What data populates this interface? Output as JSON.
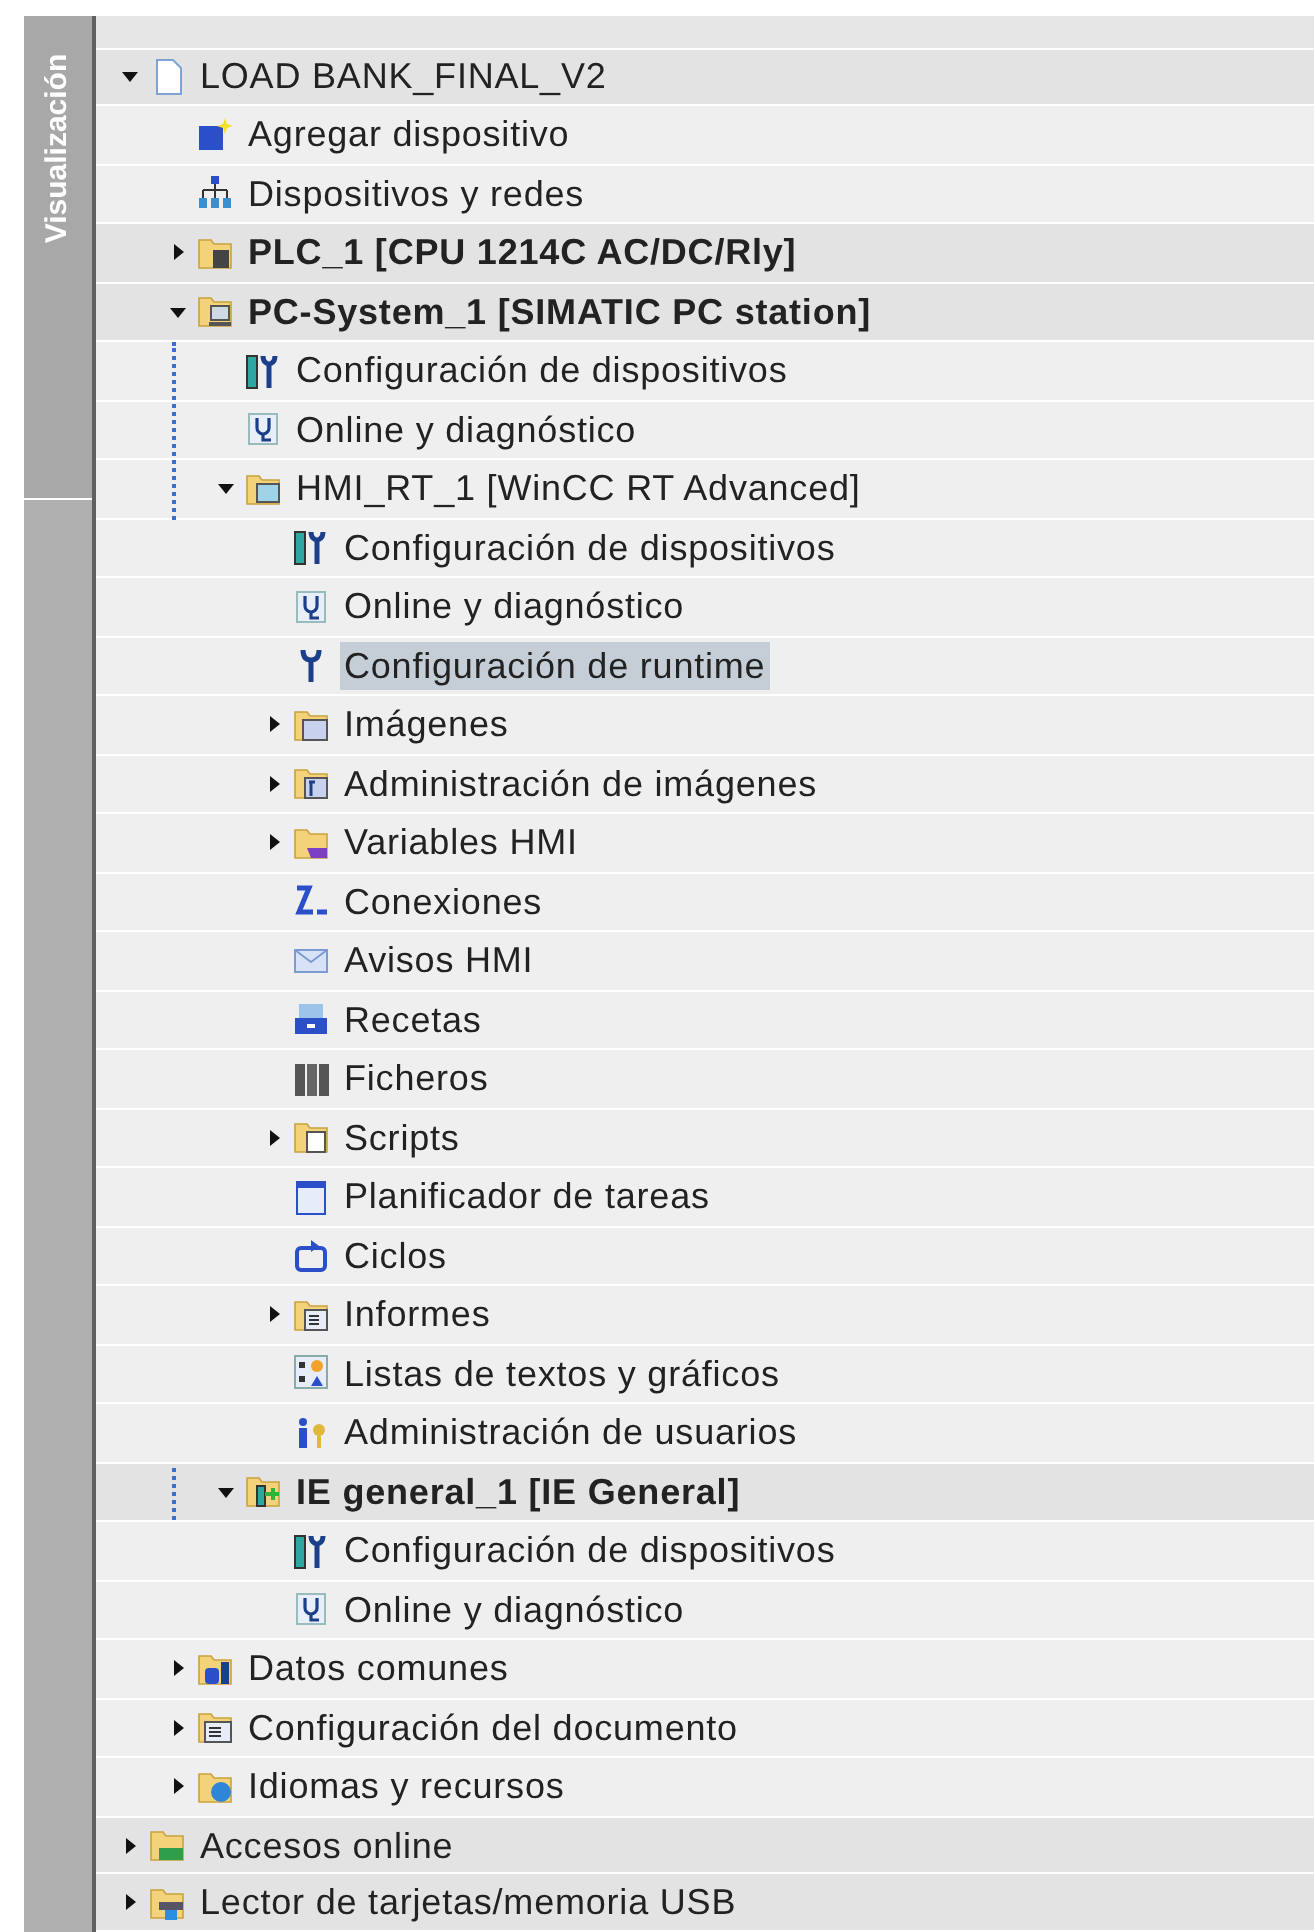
{
  "side_tab": {
    "label": "Visualización"
  },
  "tree": [
    {
      "label": "LOAD BANK_FINAL_V2",
      "kind": "project",
      "expanded": true,
      "selected": false,
      "children": [
        {
          "label": "Agregar dispositivo",
          "kind": "add",
          "selected": false
        },
        {
          "label": "Dispositivos y redes",
          "kind": "network",
          "selected": false
        },
        {
          "label": "PLC_1 [CPU 1214C AC/DC/Rly]",
          "kind": "plc",
          "bold": true,
          "expanded": false,
          "selected": false
        },
        {
          "label": "PC-System_1 [SIMATIC PC station]",
          "kind": "pc",
          "bold": true,
          "expanded": true,
          "selected": false,
          "children": [
            {
              "label": "Configuración de dispositivos",
              "kind": "devconfig",
              "selected": false
            },
            {
              "label": "Online y diagnóstico",
              "kind": "diag",
              "selected": false
            },
            {
              "label": "HMI_RT_1 [WinCC RT Advanced]",
              "kind": "hmi",
              "expanded": true,
              "selected": false,
              "children": [
                {
                  "label": "Configuración de dispositivos",
                  "kind": "devconfig",
                  "selected": false
                },
                {
                  "label": "Online y diagnóstico",
                  "kind": "diag",
                  "selected": false
                },
                {
                  "label": "Configuración de runtime",
                  "kind": "wrench",
                  "selected": true
                },
                {
                  "label": "Imágenes",
                  "kind": "screens",
                  "expanded": false,
                  "selected": false
                },
                {
                  "label": "Administración de imágenes",
                  "kind": "screenadmin",
                  "expanded": false,
                  "selected": false
                },
                {
                  "label": "Variables HMI",
                  "kind": "tags",
                  "expanded": false,
                  "selected": false
                },
                {
                  "label": "Conexiones",
                  "kind": "connections",
                  "selected": false
                },
                {
                  "label": "Avisos HMI",
                  "kind": "alarms",
                  "selected": false
                },
                {
                  "label": "Recetas",
                  "kind": "recipes",
                  "selected": false
                },
                {
                  "label": "Ficheros",
                  "kind": "archives",
                  "selected": false
                },
                {
                  "label": "Scripts",
                  "kind": "scripts",
                  "expanded": false,
                  "selected": false
                },
                {
                  "label": "Planificador de tareas",
                  "kind": "scheduler",
                  "selected": false
                },
                {
                  "label": "Ciclos",
                  "kind": "cycles",
                  "selected": false
                },
                {
                  "label": "Informes",
                  "kind": "reports",
                  "expanded": false,
                  "selected": false
                },
                {
                  "label": "Listas de textos y gráficos",
                  "kind": "textlists",
                  "selected": false
                },
                {
                  "label": "Administración de usuarios",
                  "kind": "users",
                  "selected": false
                }
              ]
            },
            {
              "label": "IE general_1 [IE General]",
              "kind": "ie",
              "bold": true,
              "expanded": true,
              "selected": false,
              "children": [
                {
                  "label": "Configuración de dispositivos",
                  "kind": "devconfig",
                  "selected": false
                },
                {
                  "label": "Online y diagnóstico",
                  "kind": "diag",
                  "selected": false
                }
              ]
            }
          ]
        },
        {
          "label": "Datos comunes",
          "kind": "common",
          "expanded": false,
          "selected": false
        },
        {
          "label": "Configuración del documento",
          "kind": "docsettings",
          "expanded": false,
          "selected": false
        },
        {
          "label": "Idiomas y recursos",
          "kind": "languages",
          "expanded": false,
          "selected": false
        }
      ]
    },
    {
      "label": "Accesos online",
      "kind": "online",
      "expanded": false,
      "selected": false
    },
    {
      "label": "Lector de tarjetas/memoria USB",
      "kind": "cardreader",
      "expanded": false,
      "selected": false
    }
  ]
}
